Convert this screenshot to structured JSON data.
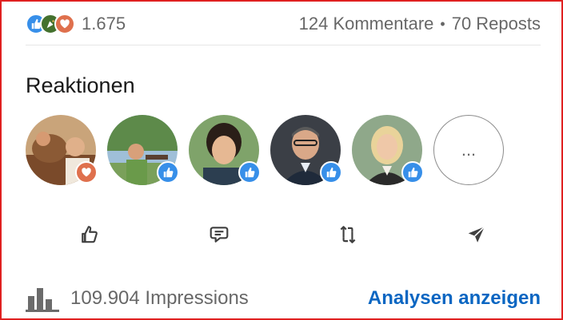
{
  "social_counts": {
    "reaction_count": "1.675",
    "comments": "124 Kommentare",
    "separator": "•",
    "reposts": "70 Reposts",
    "reaction_icons": [
      "like-icon",
      "celebrate-icon",
      "love-icon"
    ]
  },
  "reactions": {
    "title": "Reaktionen",
    "avatars": [
      {
        "reaction": "love-icon"
      },
      {
        "reaction": "like-icon"
      },
      {
        "reaction": "like-icon"
      },
      {
        "reaction": "like-icon"
      },
      {
        "reaction": "like-icon"
      }
    ],
    "more_label": "..."
  },
  "actions": [
    "like-icon",
    "comment-icon",
    "repost-icon",
    "send-icon"
  ],
  "impressions": {
    "count_text": "109.904 Impressions",
    "analytics_link": "Analysen anzeigen"
  },
  "colors": {
    "accent": "#0a66c2",
    "like_blue": "#378fe9",
    "love_red": "#df704d",
    "celebrate_green": "#44712e",
    "frame_red": "#e02020"
  }
}
